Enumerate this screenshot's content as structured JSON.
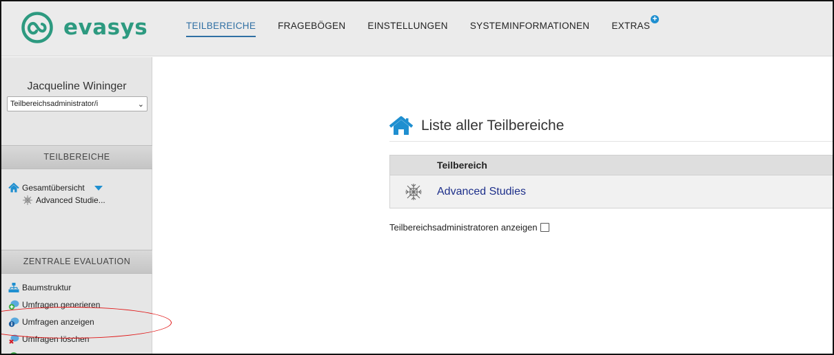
{
  "brand": {
    "name": "evasys"
  },
  "nav": {
    "items": [
      {
        "label": "TEILBEREICHE",
        "active": true
      },
      {
        "label": "FRAGEBÖGEN",
        "active": false
      },
      {
        "label": "EINSTELLUNGEN",
        "active": false
      },
      {
        "label": "SYSTEMINFORMATIONEN",
        "active": false
      },
      {
        "label": "EXTRAS",
        "active": false
      }
    ]
  },
  "sidebar": {
    "user_name": "Jacqueline Wininger",
    "role_value": "Teilbereichsadministrator/i",
    "sections": [
      {
        "title": "TEILBEREICHE",
        "items": [
          {
            "label": "Gesamtübersicht",
            "icon": "home-icon"
          },
          {
            "label": "Advanced Studie...",
            "icon": "snowflake-icon"
          }
        ]
      },
      {
        "title": "ZENTRALE EVALUATION",
        "items": [
          {
            "label": "Baumstruktur",
            "icon": "sitemap-icon"
          },
          {
            "label": "Umfragen generieren",
            "icon": "survey-add-icon"
          },
          {
            "label": "Umfragen anzeigen",
            "icon": "survey-view-icon"
          },
          {
            "label": "Umfragen löschen",
            "icon": "survey-delete-icon"
          }
        ]
      }
    ]
  },
  "main": {
    "title": "Liste aller Teilbereiche",
    "table": {
      "header": "Teilbereich",
      "rows": [
        {
          "name": "Advanced Studies",
          "icon": "snowflake-icon"
        }
      ]
    },
    "admin_toggle_label": "Teilbereichsadministratoren anzeigen"
  },
  "colors": {
    "brand": "#2d9a80",
    "accent": "#1f8fd0",
    "active_nav": "#2f6fa3",
    "link": "#1d2f8a",
    "highlight": "#e01010"
  }
}
